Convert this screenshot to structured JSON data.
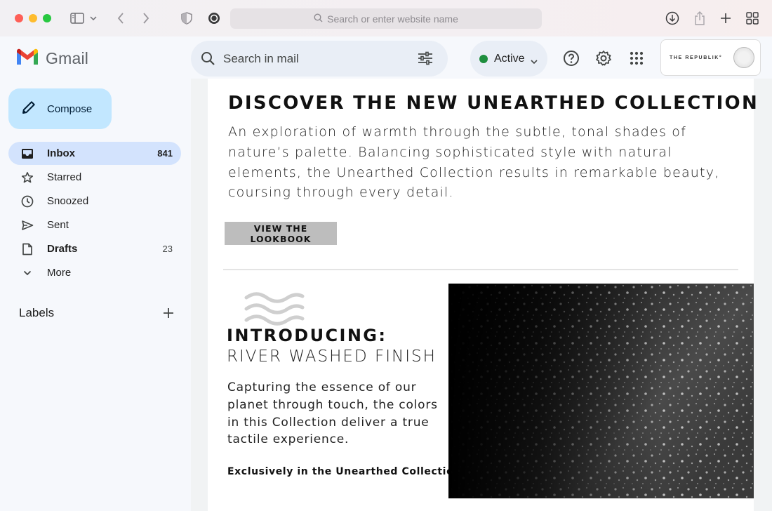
{
  "browser": {
    "url_placeholder": "Search or enter website name",
    "icons": [
      "sidebar-icon",
      "chevron-down-icon",
      "back-icon",
      "forward-icon",
      "shield-icon",
      "extension-icon",
      "search-icon",
      "download-icon",
      "share-icon",
      "new-tab-icon",
      "tab-overview-icon"
    ]
  },
  "app": {
    "name": "Gmail",
    "search_placeholder": "Search in mail",
    "status_label": "Active",
    "status_color": "#1e8e3e",
    "header_icons": [
      "help-icon",
      "settings-icon",
      "apps-icon"
    ]
  },
  "account": {
    "brand_name": "THE REPUBLIK°"
  },
  "sidebar": {
    "compose_label": "Compose",
    "items": [
      {
        "label": "Inbox",
        "count": "841",
        "icon": "inbox-icon",
        "active": true
      },
      {
        "label": "Starred",
        "count": "",
        "icon": "star-icon"
      },
      {
        "label": "Snoozed",
        "count": "",
        "icon": "clock-icon"
      },
      {
        "label": "Sent",
        "count": "",
        "icon": "send-icon"
      },
      {
        "label": "Drafts",
        "count": "23",
        "icon": "draft-icon"
      },
      {
        "label": "More",
        "count": "",
        "icon": "chevron-down-icon"
      }
    ],
    "labels_title": "Labels"
  },
  "email": {
    "headline": "DISCOVER THE NEW UNEARTHED COLLECTION",
    "lede": "An exploration of warmth through the subtle, tonal shades of nature’s palette. Balancing sophisticated style with natural elements, the Unearthed Collection results in remarkable beauty, coursing through every detail.",
    "cta_label": "VIEW THE LOOKBOOK",
    "intro_title": "INTRODUCING:",
    "intro_subtitle": "RIVER WASHED FINISH",
    "intro_body": "Capturing the essence of our planet through touch, the colors in this Collection deliver a true tactile experience.",
    "intro_note": "Exclusively in the Unearthed Collection."
  }
}
